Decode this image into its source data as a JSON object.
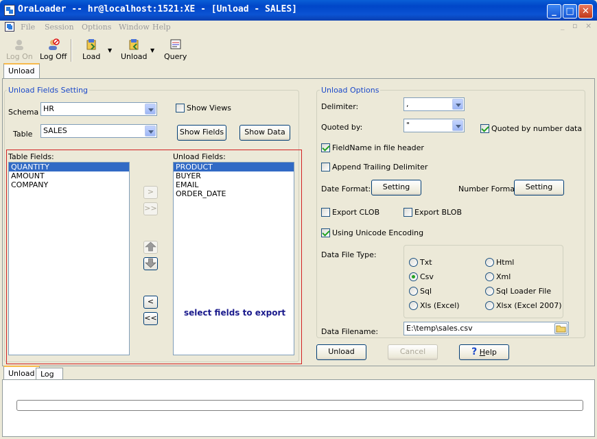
{
  "window": {
    "title": "OraLoader -- hr@localhost:1521:XE - [Unload - SALES]",
    "minimize": "_",
    "maximize": "□",
    "close": "✕"
  },
  "menu": [
    "File",
    "Session",
    "Options",
    "Window",
    "Help"
  ],
  "mdi_controls": [
    "_",
    "▫",
    "×"
  ],
  "toolbar": {
    "logon": "Log On",
    "logoff": "Log Off",
    "load": "Load",
    "unload": "Unload",
    "query": "Query"
  },
  "top_tab": "Unload",
  "fields_setting": {
    "legend": "Unload Fields Setting",
    "schema_label": "Schema",
    "schema_value": "HR",
    "show_views": "Show Views",
    "show_views_checked": false,
    "table_label": "Table",
    "table_value": "SALES",
    "show_fields_btn": "Show Fields",
    "show_data_btn": "Show Data",
    "table_fields_label": "Table Fields:",
    "table_fields": [
      "QUANTITY",
      "AMOUNT",
      "COMPANY"
    ],
    "unload_fields_label": "Unload Fields:",
    "unload_fields": [
      "PRODUCT",
      "BUYER",
      "EMAIL",
      "ORDER_DATE"
    ],
    "move_right": ">",
    "move_all_right": ">>",
    "move_left": "<",
    "move_all_left": "<<",
    "hint": "select fields to export",
    "hint_color": "#1A1A8C"
  },
  "options": {
    "legend": "Unload Options",
    "delimiter_label": "Delimiter:",
    "delimiter_value": ",",
    "quoted_by_label": "Quoted by:",
    "quoted_by_value": "\"",
    "quoted_number": "Quoted by number data",
    "fieldname_header": "FieldName in file header",
    "append_trailing": "Append Trailing Delimiter",
    "date_format_label": "Date Format:",
    "date_setting_btn": "Setting",
    "number_format_label": "Number Format:",
    "number_setting_btn": "Setting",
    "export_clob": "Export CLOB",
    "export_blob": "Export BLOB",
    "unicode": "Using Unicode Encoding",
    "file_type_label": "Data File Type:",
    "file_types": [
      "Txt",
      "Csv",
      "Sql",
      "Xls (Excel)",
      "Html",
      "Xml",
      "Sql Loader File",
      "Xlsx (Excel 2007)"
    ],
    "file_type_selected": "Csv",
    "data_filename_label": "Data Filename:",
    "data_filename": "E:\\temp\\sales.csv"
  },
  "actions": {
    "unload": "Unload",
    "cancel": "Cancel",
    "help": "Help",
    "help_mnemonic": "H",
    "help_rest": "elp"
  },
  "bottom_tabs": [
    "Unload",
    "Log"
  ],
  "accent": {
    "highlight_box": "#D22020",
    "selection": "#316AC5",
    "legend": "#1A48C9"
  }
}
